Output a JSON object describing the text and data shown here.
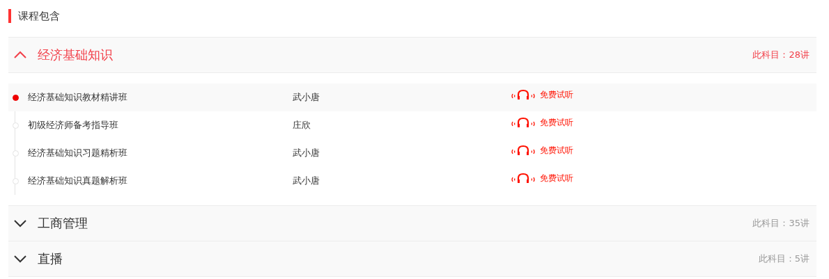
{
  "section_title": "课程包含",
  "subjects": [
    {
      "name": "经济基础知识",
      "count": "此科目：28讲",
      "expanded": true,
      "lessons": [
        {
          "title": "经济基础知识教材精讲班",
          "teacher": "武小唐",
          "trial": "免费试听",
          "selected": true
        },
        {
          "title": "初级经济师备考指导班",
          "teacher": "庄欣",
          "trial": "免费试听",
          "selected": false
        },
        {
          "title": "经济基础知识习题精析班",
          "teacher": "武小唐",
          "trial": "免费试听",
          "selected": false
        },
        {
          "title": "经济基础知识真题解析班",
          "teacher": "武小唐",
          "trial": "免费试听",
          "selected": false
        }
      ]
    },
    {
      "name": "工商管理",
      "count": "此科目：35讲",
      "expanded": false
    },
    {
      "name": "直播",
      "count": "此科目：5讲",
      "expanded": false
    }
  ]
}
